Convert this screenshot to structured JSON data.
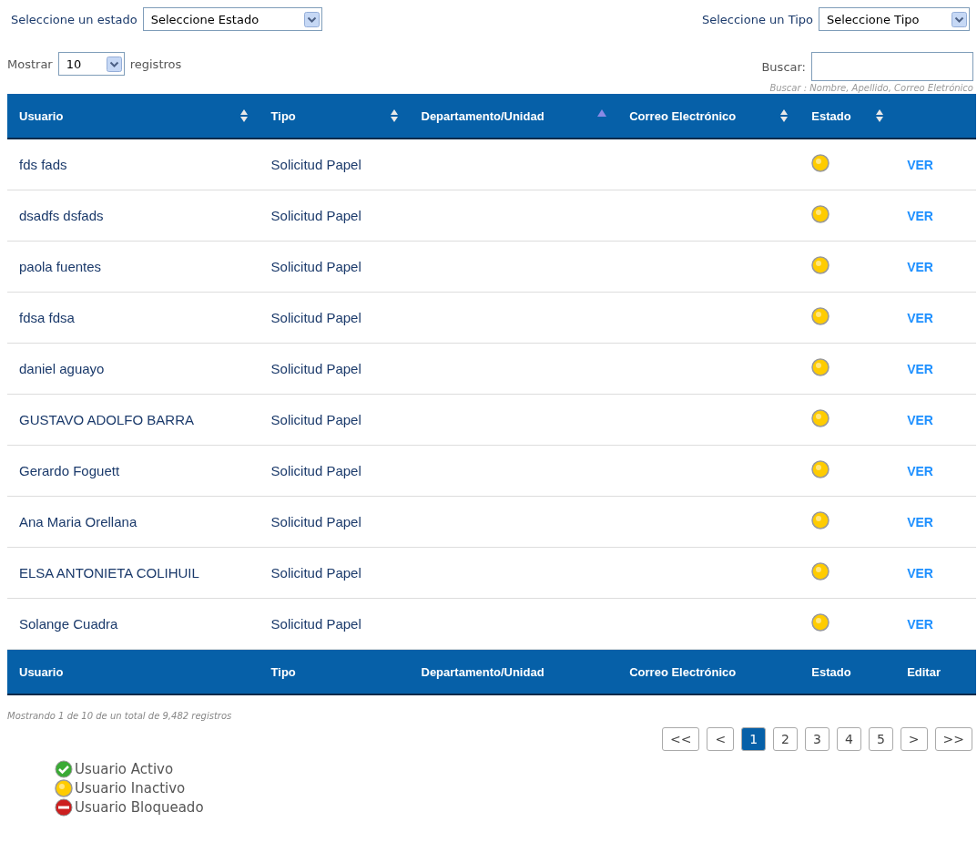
{
  "filters": [
    {
      "label": "Seleccione un estado",
      "value": "Seleccione Estado"
    },
    {
      "label": "Seleccione un Tipo",
      "value": "Seleccione Tipo"
    }
  ],
  "length": {
    "before": "Mostrar",
    "value": "10",
    "after": "registros"
  },
  "search": {
    "label": "Buscar:",
    "hint": "Buscar : Nombre, Apellido, Correo Eletrónico"
  },
  "table": {
    "columns": [
      {
        "label": "Usuario",
        "kind": "sortable"
      },
      {
        "label": "Tipo",
        "kind": "sortable"
      },
      {
        "label": "Departamento/Unidad",
        "kind": "sorted"
      },
      {
        "label": "Correo Electrónico",
        "kind": "sortable"
      },
      {
        "label": "Estado",
        "kind": "sortable"
      },
      {
        "kind": "plain"
      }
    ],
    "rows": [
      {
        "user": "fds fads",
        "type": "Solicitud Papel",
        "kind": "inactive",
        "action": "VER"
      },
      {
        "user": "dsadfs dsfads",
        "type": "Solicitud Papel",
        "kind": "inactive",
        "action": "VER"
      },
      {
        "user": "paola fuentes",
        "type": "Solicitud Papel",
        "kind": "inactive",
        "action": "VER"
      },
      {
        "user": "fdsa fdsa",
        "type": "Solicitud Papel",
        "kind": "inactive",
        "action": "VER"
      },
      {
        "user": "daniel aguayo",
        "type": "Solicitud Papel",
        "kind": "inactive",
        "action": "VER"
      },
      {
        "user": "GUSTAVO ADOLFO BARRA",
        "type": "Solicitud Papel",
        "kind": "inactive",
        "action": "VER"
      },
      {
        "user": "Gerardo Foguett",
        "type": "Solicitud Papel",
        "kind": "inactive",
        "action": "VER"
      },
      {
        "user": "Ana Maria Orellana",
        "type": "Solicitud Papel",
        "kind": "inactive",
        "action": "VER"
      },
      {
        "user": "ELSA ANTONIETA COLIHUIL",
        "type": "Solicitud Papel",
        "kind": "inactive",
        "action": "VER"
      },
      {
        "user": "Solange Cuadra",
        "type": "Solicitud Papel",
        "kind": "inactive",
        "action": "VER"
      }
    ],
    "footer": [
      "Usuario",
      "Tipo",
      "Departamento/Unidad",
      "Correo Electrónico",
      "Estado",
      "Editar"
    ]
  },
  "info": "Mostrando 1 de 10 de un total de 9,482 registros",
  "pagination": [
    {
      "label": "<<",
      "selected": false
    },
    {
      "label": "<",
      "selected": false
    },
    {
      "label": "1",
      "selected": true
    },
    {
      "label": "2",
      "selected": false
    },
    {
      "label": "3",
      "selected": false
    },
    {
      "label": "4",
      "selected": false
    },
    {
      "label": "5",
      "selected": false
    },
    {
      "label": ">",
      "selected": false
    },
    {
      "label": ">>",
      "selected": false
    }
  ],
  "legend": [
    {
      "kind": "active",
      "label": "Usuario Activo"
    },
    {
      "kind": "inactive",
      "label": "Usuario Inactivo"
    },
    {
      "kind": "blocked",
      "label": "Usuario Bloqueado"
    }
  ]
}
